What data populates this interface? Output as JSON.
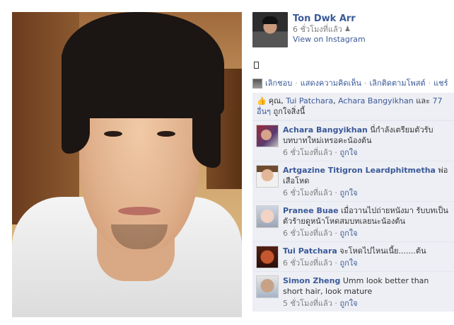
{
  "post": {
    "author": "Ton Dwk Arr",
    "time": "6 ชั่วโมงที่แล้ว",
    "privacy_icon": "people-icon",
    "via_link": "View on Instagram",
    "status_text": "□"
  },
  "actions": {
    "unlike": "เลิกชอบ",
    "comment": "แสดงความคิดเห็น",
    "unfollow": "เลิกติดตามโพสต์",
    "share": "แชร์",
    "separator": "·"
  },
  "likes": {
    "prefix": "คุณ, ",
    "name1": "Tui Patchara",
    "sep": ", ",
    "name2": "Achara Bangyikhan",
    "and": " และ ",
    "others": "77 อื่นๆ",
    "suffix": " ถูกใจสิ่งนี้"
  },
  "comments": [
    {
      "name": "Achara Bangyikhan",
      "text": "นี่กำลังเตรียมตัวรับบทบาทใหม่เหรอคะน้องต้น",
      "time": "6 ชั่วโมงที่แล้ว",
      "like": "ถูกใจ"
    },
    {
      "name": "Artgazine Titigron Leardphitmetha",
      "text": "พ่อเสือโหด",
      "time": "6 ชั่วโมงที่แล้ว",
      "like": "ถูกใจ"
    },
    {
      "name": "Pranee Buae",
      "text": "เมื่อวานไปถ่ายหนังมา รับบทเป็นตัวร้ายดูหน้าโหดสมบทเลยนะน้องต้น",
      "time": "6 ชั่วโมงที่แล้ว",
      "like": "ถูกใจ"
    },
    {
      "name": "Tui Patchara",
      "text": "จะโหดไปไหนเนี้ย.......ต้น",
      "time": "6 ชั่วโมงที่แล้ว",
      "like": "ถูกใจ"
    },
    {
      "name": "Simon Zheng",
      "text": "Umm look better than short hair, look mature",
      "time": "5 ชั่วโมงที่แล้ว",
      "like": "ถูกใจ"
    }
  ]
}
